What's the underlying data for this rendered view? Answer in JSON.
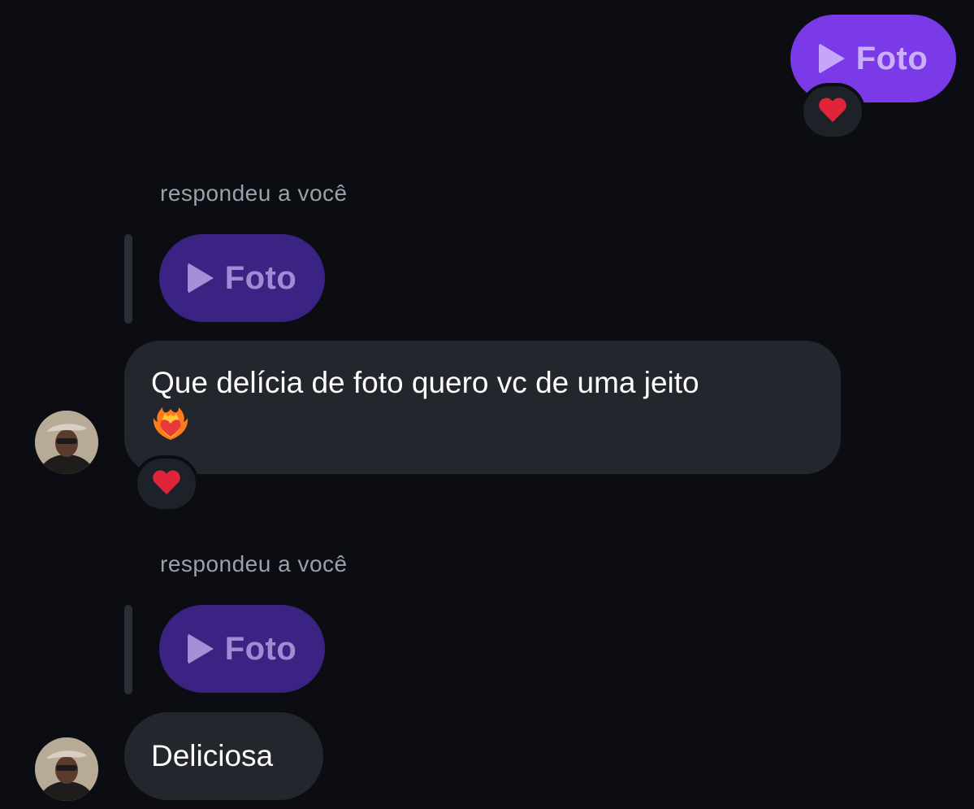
{
  "messages": {
    "sent_photo": {
      "label": "Foto",
      "reaction": "❤️"
    },
    "reply1": {
      "caption": "respondeu a você",
      "quoted_label": "Foto",
      "text": "Que delícia de foto quero vc de uma jeito",
      "reaction": "❤️"
    },
    "reply2": {
      "caption": "respondeu a você",
      "quoted_label": "Foto",
      "text": "Deliciosa"
    }
  },
  "colors": {
    "background": "#0b0d12",
    "sent_bubble": "#7b3ae8",
    "quoted_bubble": "#3a2382",
    "received_bubble": "#23262c",
    "reaction_heart": "#e0243a"
  },
  "icons": {
    "play": "play-icon",
    "heart": "heart-icon",
    "heart_on_fire": "heart-on-fire-icon",
    "avatar": "avatar"
  }
}
